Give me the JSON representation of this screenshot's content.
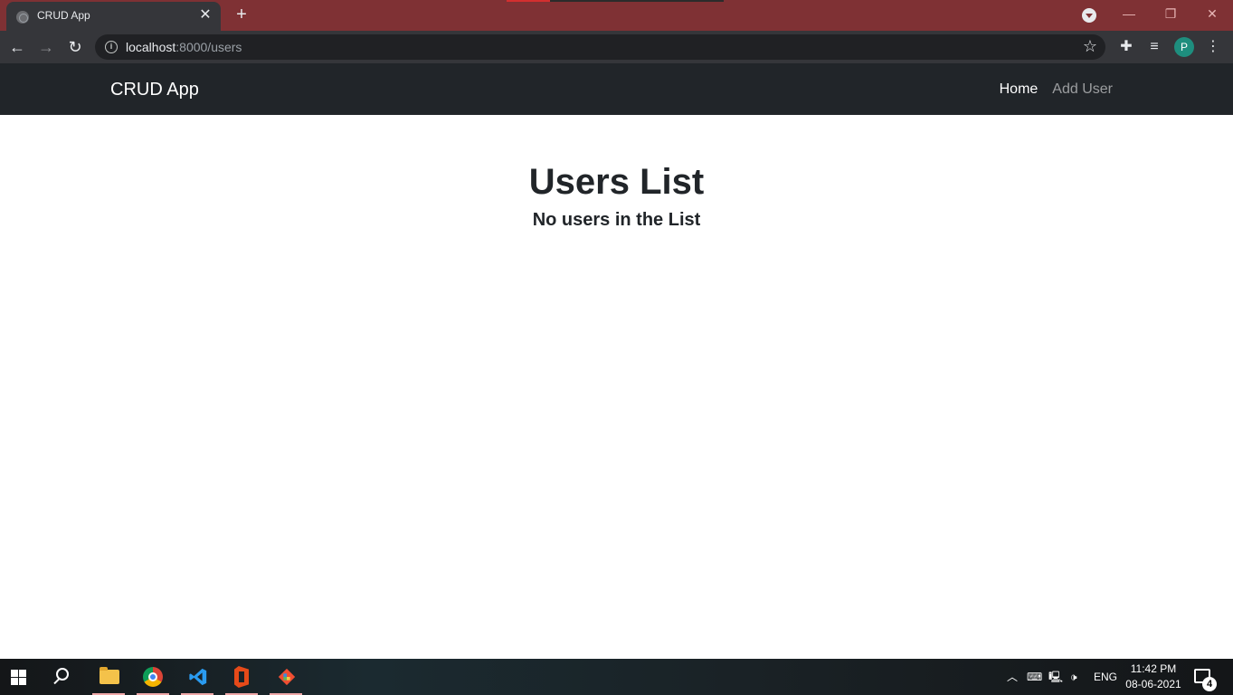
{
  "browser": {
    "tab_title": "CRUD App",
    "tab_close": "✕",
    "new_tab": "+",
    "url_host": "localhost",
    "url_rest": ":8000/users",
    "profile_initial": "P",
    "window_controls": {
      "minimize": "—",
      "restore": "❐",
      "close": "✕"
    }
  },
  "app": {
    "brand": "CRUD App",
    "nav": [
      {
        "label": "Home",
        "active": true
      },
      {
        "label": "Add User",
        "active": false
      }
    ]
  },
  "main": {
    "title": "Users List",
    "empty_message": "No users in the List"
  },
  "taskbar": {
    "apps": [
      "start-icon",
      "search-icon",
      "file-explorer-icon",
      "chrome-icon",
      "vscode-icon",
      "office-icon",
      "git-icon"
    ],
    "language": "ENG",
    "time": "11:42 PM",
    "date": "08-06-2021",
    "notification_count": "4"
  },
  "colors": {
    "tabstrip": "#7f3134",
    "navbar": "#212529",
    "toolbar": "#35363a",
    "profile": "#1e8e7e"
  }
}
